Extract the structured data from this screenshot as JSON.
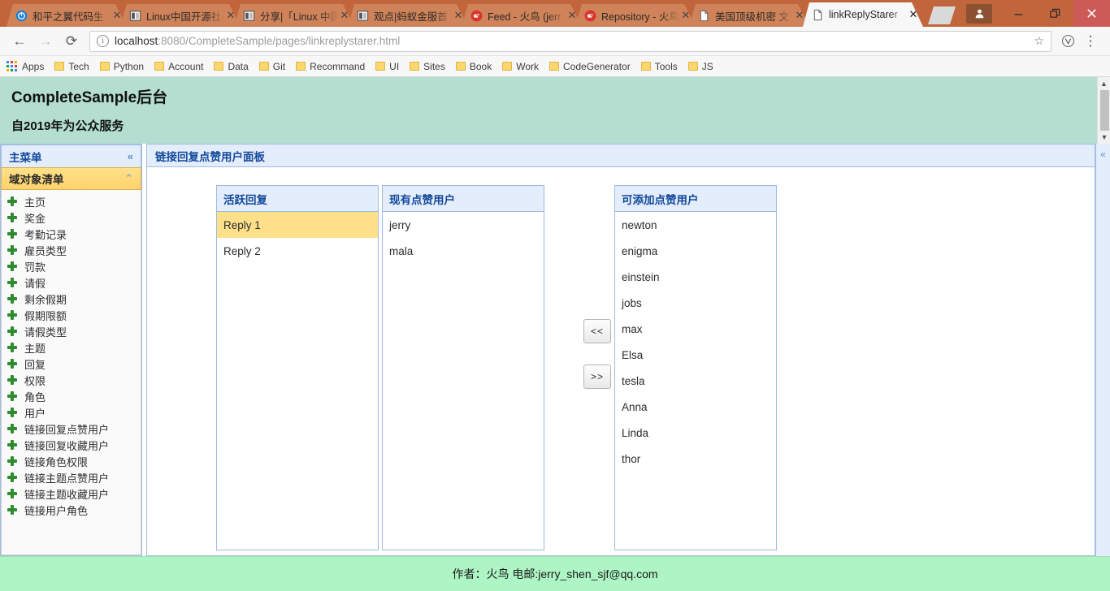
{
  "browser": {
    "tabs": [
      {
        "title": "和平之翼代码生",
        "favicon": "circle-blue-favicon",
        "active": false
      },
      {
        "title": "Linux中国开源社",
        "favicon": "book-favicon",
        "active": false
      },
      {
        "title": "分享|「Linux 中国",
        "favicon": "book-favicon",
        "active": false
      },
      {
        "title": "观点|蚂蚁金服首",
        "favicon": "book-favicon",
        "active": false
      },
      {
        "title": "Feed - 火鸟 (jerr",
        "favicon": "gitee-favicon",
        "active": false
      },
      {
        "title": "Repository - 火鸟",
        "favicon": "gitee-favicon",
        "active": false
      },
      {
        "title": "美国顶级机密 文",
        "favicon": "document-favicon",
        "active": false
      },
      {
        "title": "linkReplyStarer",
        "favicon": "document-favicon",
        "active": true
      }
    ],
    "tab_close_label": "✕",
    "new_tab_label": "",
    "window_controls": {
      "profile": "profile-icon",
      "minimize": "—",
      "restore": "❐",
      "close": "✕"
    },
    "toolbar": {
      "back": "←",
      "forward": "→",
      "reload": "⟳",
      "info_icon": "i",
      "url_host": "localhost",
      "url_rest": ":8080/CompleteSample/pages/linkreplystarer.html",
      "star": "☆",
      "extension": "Ⓥ",
      "menu": "⋮"
    },
    "bookmarks": {
      "apps_label": "Apps",
      "items": [
        "Tech",
        "Python",
        "Account",
        "Data",
        "Git",
        "Recommand",
        "UI",
        "Sites",
        "Book",
        "Work",
        "CodeGenerator",
        "Tools",
        "JS"
      ]
    }
  },
  "banner": {
    "title": "CompleteSample后台",
    "subtitle": "自2019年为公众服务"
  },
  "sidebar": {
    "main_menu_label": "主菜单",
    "main_menu_chevron": "«",
    "domain_list_label": "域对象清单",
    "domain_list_chevron": "⌃",
    "items": [
      "主页",
      "奖金",
      "考勤记录",
      "雇员类型",
      "罚款",
      "请假",
      "剩余假期",
      "假期限额",
      "请假类型",
      "主题",
      "回复",
      "权限",
      "角色",
      "用户",
      "链接回复点赞用户",
      "链接回复收藏用户",
      "链接角色权限",
      "链接主题点赞用户",
      "链接主题收藏用户",
      "链接用户角色"
    ]
  },
  "main": {
    "panel_title": "链接回复点赞用户面板",
    "right_collapse_chevron": "«",
    "panels": [
      {
        "header": "活跃回复",
        "rows": [
          {
            "label": "Reply 1",
            "selected": true
          },
          {
            "label": "Reply 2",
            "selected": false
          }
        ]
      },
      {
        "header": "现有点赞用户",
        "rows": [
          {
            "label": "jerry",
            "selected": false
          },
          {
            "label": "mala",
            "selected": false
          }
        ]
      },
      {
        "header": "可添加点赞用户",
        "rows": [
          {
            "label": "newton",
            "selected": false
          },
          {
            "label": "enigma",
            "selected": false
          },
          {
            "label": "einstein",
            "selected": false
          },
          {
            "label": "jobs",
            "selected": false
          },
          {
            "label": "max",
            "selected": false
          },
          {
            "label": "Elsa",
            "selected": false
          },
          {
            "label": "tesla",
            "selected": false
          },
          {
            "label": "Anna",
            "selected": false
          },
          {
            "label": "Linda",
            "selected": false
          },
          {
            "label": "thor",
            "selected": false
          }
        ]
      }
    ],
    "buttons": {
      "move_left": "<<",
      "move_right": ">>"
    }
  },
  "footer": {
    "text": "作者：火鸟 电邮:jerry_shen_sjf@qq.com"
  },
  "colors": {
    "banner_bg": "#b3ded0",
    "footer_bg": "#adf5c4",
    "panel_header_bg": "#e4edfb",
    "panel_border": "#9dbbe0",
    "selected_row": "#ffe08a",
    "accent_text": "#13499b",
    "chrome_frame": "#c1663c"
  }
}
